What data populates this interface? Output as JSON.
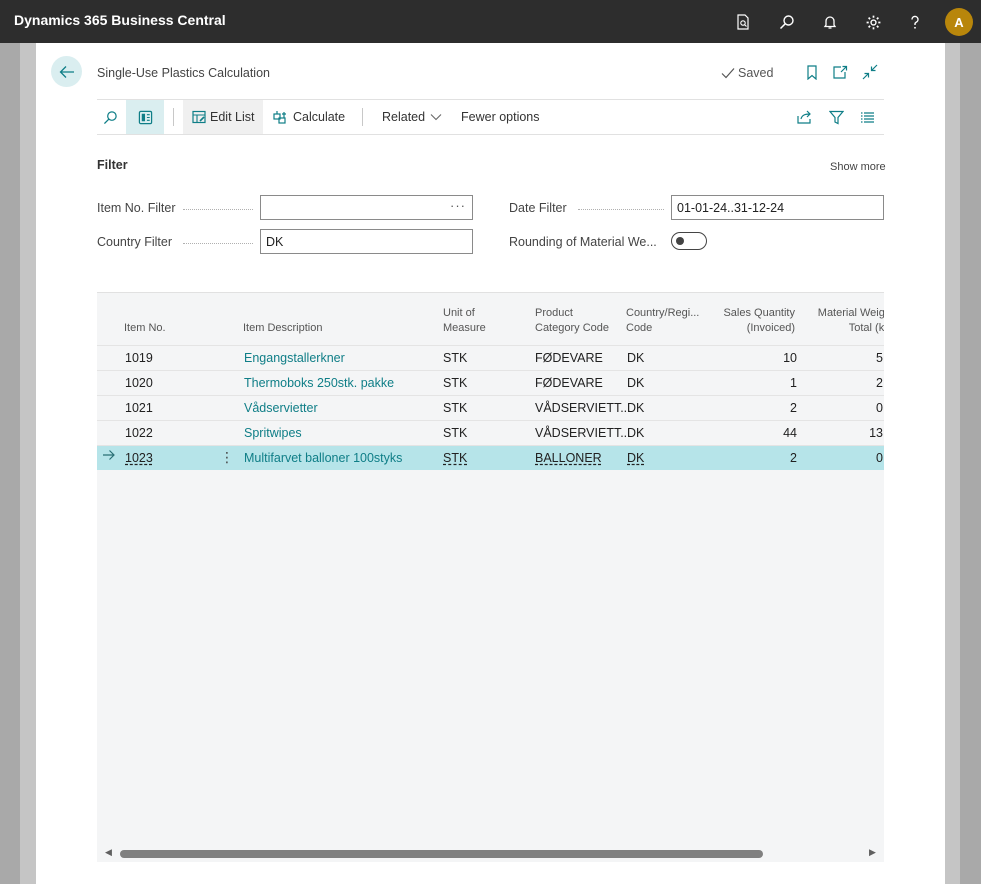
{
  "app": {
    "title": "Dynamics 365 Business Central",
    "user_initial": "A"
  },
  "topbar_icons": [
    "document-search-icon",
    "search-icon",
    "bell-icon",
    "gear-icon",
    "help-icon"
  ],
  "page": {
    "title": "Single-Use Plastics Calculation",
    "saved_label": "Saved"
  },
  "actions": {
    "edit_list": "Edit List",
    "calculate": "Calculate",
    "related": "Related",
    "fewer_options": "Fewer options"
  },
  "filter": {
    "section_title": "Filter",
    "show_more": "Show more",
    "item_no_label": "Item No. Filter",
    "item_no_value": "",
    "country_label": "Country Filter",
    "country_value": "DK",
    "date_label": "Date Filter",
    "date_value": "01-01-24..31-12-24",
    "rounding_label": "Rounding of Material We...",
    "rounding_enabled": false
  },
  "grid": {
    "headers": {
      "item_no": "Item No.",
      "description": "Item Description",
      "uom_1": "Unit of",
      "uom_2": "Measure",
      "pcc_1": "Product",
      "pcc_2": "Category Code",
      "country_1": "Country/Regi...",
      "country_2": "Code",
      "sales_1": "Sales Quantity",
      "sales_2": "(Invoiced)",
      "mat_1": "Material Weight",
      "mat_2": "Total (kg)"
    },
    "rows": [
      {
        "item_no": "1019",
        "description": "Engangstallerkner",
        "uom": "STK",
        "category": "FØDEVARE",
        "country": "DK",
        "sales_qty": "10",
        "material_total": "5"
      },
      {
        "item_no": "1020",
        "description": "Thermoboks 250stk. pakke",
        "uom": "STK",
        "category": "FØDEVARE",
        "country": "DK",
        "sales_qty": "1",
        "material_total": "2"
      },
      {
        "item_no": "1021",
        "description": "Vådservietter",
        "uom": "STK",
        "category": "VÅDSERVIETT...",
        "country": "DK",
        "sales_qty": "2",
        "material_total": "0"
      },
      {
        "item_no": "1022",
        "description": "Spritwipes",
        "uom": "STK",
        "category": "VÅDSERVIETT...",
        "country": "DK",
        "sales_qty": "44",
        "material_total": "13"
      },
      {
        "item_no": "1023",
        "description": "Multifarvet balloner 100styks",
        "uom": "STK",
        "category": "BALLONER",
        "country": "DK",
        "sales_qty": "2",
        "material_total": "0"
      }
    ],
    "selected_row": 4
  },
  "colors": {
    "topbar": "#2d2d2d",
    "accent": "#0f7e87",
    "selected_row": "#b6e4e9",
    "avatar": "#b8860b"
  }
}
